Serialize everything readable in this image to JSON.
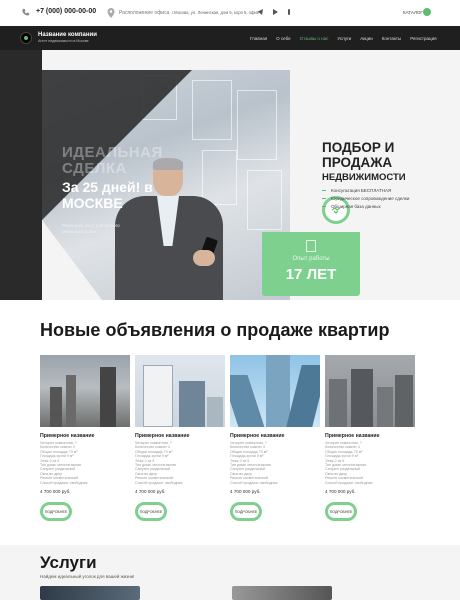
{
  "topbar": {
    "phone": "+7 (000) 000-00-00",
    "office": "Расположение офиса",
    "address": "г.Москва, ул. Ленинская, дом 5, корп 5, офис 3",
    "catalog": "КАТАЛОГ"
  },
  "header": {
    "brand": "Название компании",
    "tagline": "Агент недвижимости в Москве",
    "nav": [
      "Главная",
      "О себе",
      "Отзывы о нас",
      "Услуги",
      "Акции",
      "Контакты",
      "Регистрация"
    ],
    "nav_active_index": 2
  },
  "hero": {
    "title_faded": "ИДЕАЛЬНАЯ СДЕЛКА",
    "title_main": "За 25 дней! в МОСКВЕ",
    "subtitle": "Реальный опыт для вашего реального дома",
    "right_title_line1": "ПОДБОР И",
    "right_title_line2": "ПРОДАЖА",
    "right_title_line3": "НЕДВИЖИМОСТИ",
    "features": [
      "Консультация БЕСПЛАТНАЯ",
      "Юридическое сопровождение сделки",
      "Обширная база данных"
    ],
    "experience_label": "Опыт работы",
    "experience_value": "17 ЛЕТ"
  },
  "listings": {
    "title": "Новые объявления о продаже квартир",
    "cards": [
      {
        "name": "Примерное название",
        "specs": [
          "Четырех комнатная, ?",
          "Количество комнат 4",
          "Общая площадь 70 м²",
          "Площадь кухни 9 м²",
          "Этаж 2 из 5",
          "Тип дома: многоэтажная",
          "Санузел раздельный",
          "Окна во двор",
          "Ремонт косметический",
          "Способ продажи: свободная"
        ],
        "price": "4 700 000 руб.",
        "button": "ПОДРОБНЕЕ"
      },
      {
        "name": "Примерное название",
        "specs": [
          "Четырех комнатная, ?",
          "Количество комнат 4",
          "Общая площадь 70 м²",
          "Площадь кухни 9 м²",
          "Этаж 2 из 5",
          "Тип дома: многоэтажная",
          "Санузел раздельный",
          "Окна во двор",
          "Ремонт косметический",
          "Способ продажи: свободная"
        ],
        "price": "4 700 000 руб.",
        "button": "ПОДРОБНЕЕ"
      },
      {
        "name": "Примерное название",
        "specs": [
          "Четырех комнатная, ?",
          "Количество комнат 4",
          "Общая площадь 70 м²",
          "Площадь кухни 9 м²",
          "Этаж 2 из 5",
          "Тип дома: многоэтажная",
          "Санузел раздельный",
          "Окна во двор",
          "Ремонт косметический",
          "Способ продажи: свободная"
        ],
        "price": "4 700 000 руб.",
        "button": "ПОДРОБНЕЕ"
      },
      {
        "name": "Примерное название",
        "specs": [
          "Четырех комнатная, ?",
          "Количество комнат 4",
          "Общая площадь 70 м²",
          "Площадь кухни 9 м²",
          "Этаж 2 из 5",
          "Тип дома: многоэтажная",
          "Санузел раздельный",
          "Окна во двор",
          "Ремонт косметический",
          "Способ продажи: свободная"
        ],
        "price": "4 700 000 руб.",
        "button": "ПОДРОБНЕЕ"
      }
    ]
  },
  "services": {
    "title": "Услуги",
    "subtitle": "Найдем идеальный уголок для вашей жизни!"
  },
  "colors": {
    "accent": "#7ed08f",
    "dark": "#1f1f1f"
  },
  "icons": [
    "phone-icon",
    "map-pin-icon",
    "telegram-icon",
    "whatsapp-icon",
    "viber-icon",
    "handshake-icon",
    "document-icon"
  ]
}
